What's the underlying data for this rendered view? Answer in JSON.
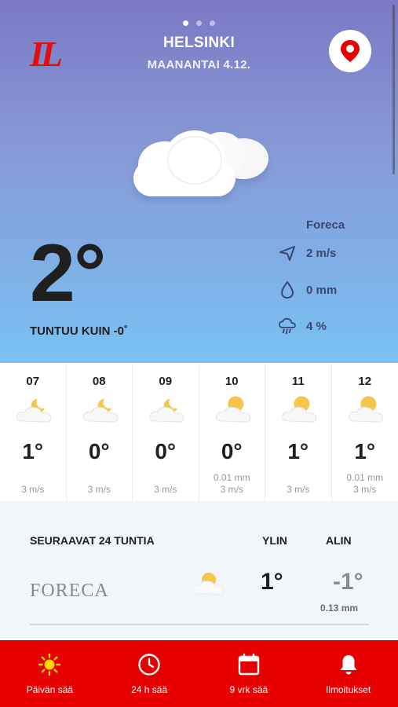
{
  "header": {
    "logo": "IL",
    "city": "HELSINKI",
    "date": "MAANANTAI 4.12.",
    "location_button": "map-pin-icon",
    "page_dots": 3,
    "active_dot": 0
  },
  "current": {
    "temperature": "2°",
    "feels_like": "TUNTUU KUIN -0˚",
    "provider": "Foreca",
    "wind": "2 m/s",
    "rain": "0 mm",
    "rain_probability": "4 %",
    "condition_icon": "cloud-icon"
  },
  "hourly": [
    {
      "time": "07",
      "temp": "1°",
      "rain": "",
      "wind": "3 m/s",
      "icon": "partly-cloudy-night-icon"
    },
    {
      "time": "08",
      "temp": "0°",
      "rain": "",
      "wind": "3 m/s",
      "icon": "partly-cloudy-night-icon"
    },
    {
      "time": "09",
      "temp": "0°",
      "rain": "",
      "wind": "3 m/s",
      "icon": "partly-cloudy-night-icon"
    },
    {
      "time": "10",
      "temp": "0°",
      "rain": "0.01 mm",
      "wind": "3 m/s",
      "icon": "partly-cloudy-day-icon"
    },
    {
      "time": "11",
      "temp": "1°",
      "rain": "",
      "wind": "3 m/s",
      "icon": "partly-cloudy-day-icon"
    },
    {
      "time": "12",
      "temp": "1°",
      "rain": "0.01 mm",
      "wind": "3 m/s",
      "icon": "partly-cloudy-day-icon"
    }
  ],
  "next24": {
    "title": "SEURAAVAT 24 TUNTIA",
    "high_label": "YLIN",
    "low_label": "ALIN",
    "provider_logo": "FORECA",
    "high": "1°",
    "low": "-1°",
    "precip": "0.13 mm",
    "icon": "partly-cloudy-day-icon"
  },
  "nav": [
    {
      "label": "Päivän sää",
      "icon": "sun-icon"
    },
    {
      "label": "24 h sää",
      "icon": "clock-icon"
    },
    {
      "label": "9 vrk sää",
      "icon": "calendar-icon"
    },
    {
      "label": "Ilmoitukset",
      "icon": "bell-icon"
    }
  ],
  "colors": {
    "brand_red": "#e60000",
    "hero_top": "#7a79c4",
    "hero_bottom": "#79c2f2",
    "text_dark": "#1f1f1f",
    "stat_text": "#3b4670"
  }
}
